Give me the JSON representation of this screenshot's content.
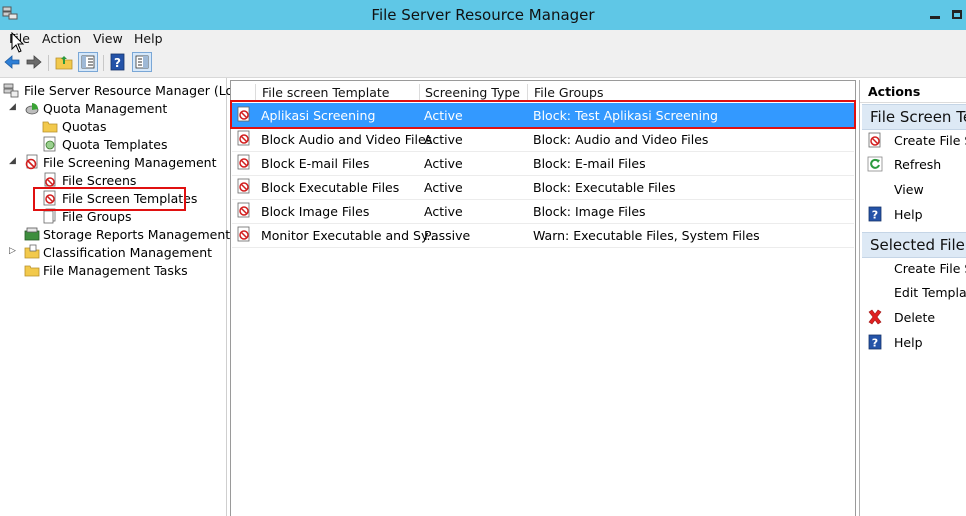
{
  "window": {
    "title": "File Server Resource Manager"
  },
  "menu": {
    "items": [
      "File",
      "Action",
      "View",
      "Help"
    ]
  },
  "toolbar": {
    "buttons": [
      "back-icon",
      "forward-icon",
      "up-folder-icon",
      "show-hide-tree-icon",
      "help-icon",
      "show-hide-action-pane-icon"
    ]
  },
  "tree": {
    "root": "File Server Resource Manager (Local)",
    "quota_management": "Quota Management",
    "quotas": "Quotas",
    "quota_templates": "Quota Templates",
    "file_screening_management": "File Screening Management",
    "file_screens": "File Screens",
    "file_screen_templates": "File Screen Templates",
    "file_groups": "File Groups",
    "storage_reports": "Storage Reports Management",
    "classification": "Classification Management",
    "file_management_tasks": "File Management Tasks"
  },
  "list": {
    "columns": [
      "File screen Template",
      "Screening Type",
      "File Groups"
    ],
    "rows": [
      {
        "template": "Aplikasi Screening",
        "type": "Active",
        "groups": "Block: Test Aplikasi Screening"
      },
      {
        "template": "Block Audio and Video Files",
        "type": "Active",
        "groups": "Block: Audio and Video Files"
      },
      {
        "template": "Block E-mail Files",
        "type": "Active",
        "groups": "Block: E-mail Files"
      },
      {
        "template": "Block Executable Files",
        "type": "Active",
        "groups": "Block: Executable Files"
      },
      {
        "template": "Block Image Files",
        "type": "Active",
        "groups": "Block: Image Files"
      },
      {
        "template": "Monitor Executable and Sy...",
        "type": "Passive",
        "groups": "Warn: Executable Files, System Files"
      }
    ]
  },
  "actions": {
    "header": "Actions",
    "section1": "File Screen Ter",
    "create": "Create File Scr",
    "refresh": "Refresh",
    "view": "View",
    "help": "Help",
    "section2": "Selected File S",
    "create2": "Create File Scr",
    "edit": "Edit Template",
    "delete": "Delete",
    "help2": "Help"
  },
  "colors": {
    "titlebar": "#5fc7e6",
    "selection": "#3399ff",
    "highlight": "#e01010"
  }
}
